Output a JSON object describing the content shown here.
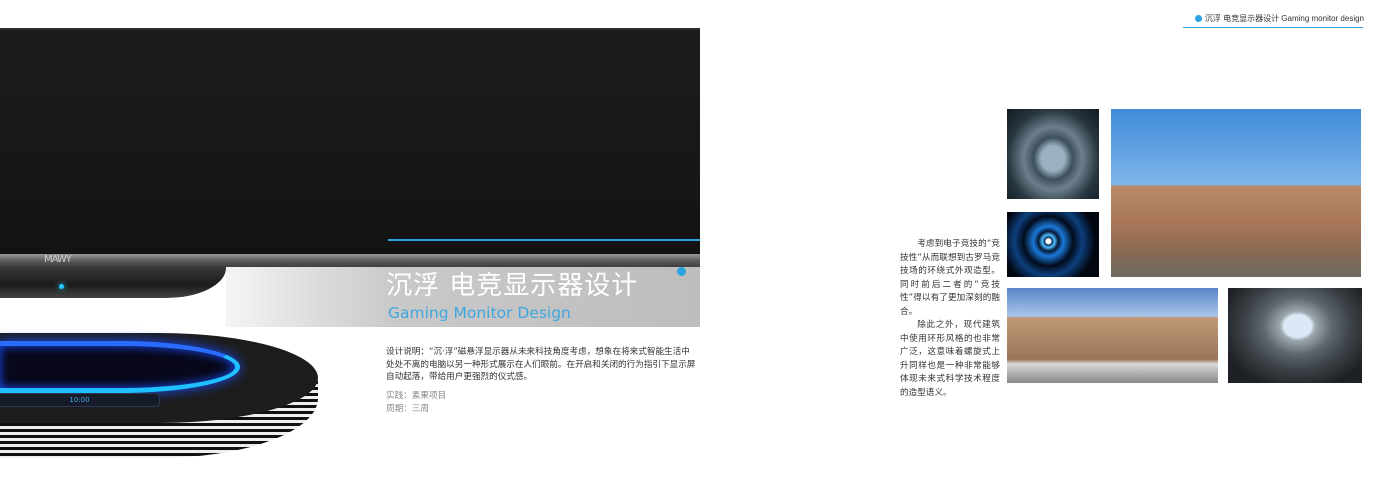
{
  "header": {
    "tag": "沉浮 电竞显示器设计 Gaming monitor design"
  },
  "product": {
    "logo": "MAWY",
    "display_time": "10:00"
  },
  "title": {
    "cn": "沉浮 电竞显示器设计",
    "en": "Gaming Monitor Design"
  },
  "description": "设计说明：“沉·浮”磁悬浮显示器从未来科技角度考虑，想象在将来式智能生活中处处不离的电脑以另一种形式展示在人们眼前。在开启和关闭的行为指引下显示屏自动起落，带给用户更强烈的仪式感。",
  "meta": {
    "practice": "实践：素果项目",
    "period": "周期：三周"
  },
  "concept": {
    "paragraph1": "考虑到电子竞技的“竞技性”从而联想到古罗马竞技场的环绕式外观造型。同时前后二者的“竞技性”得以有了更加深刻的融合。",
    "paragraph2": "除此之外，现代建筑中使用环形风格的也非常广泛，这意味着螺旋式上升同样也是一种非常能够体现未来式科学技术程度的造型语义。"
  },
  "colors": {
    "accent": "#2aa3e0",
    "screen": "#1a1a1a"
  }
}
